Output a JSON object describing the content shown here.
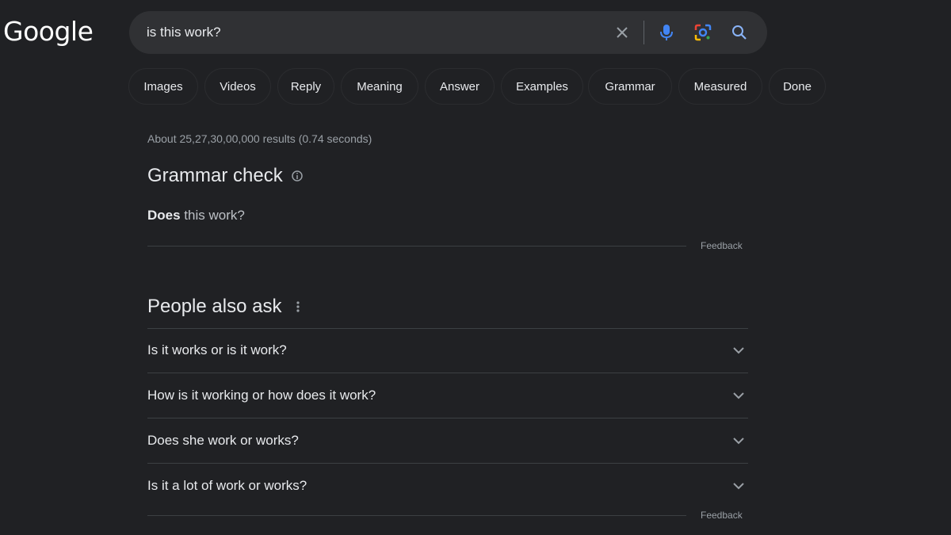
{
  "logo": "Google",
  "search": {
    "query": "is this work?"
  },
  "chips": [
    "Images",
    "Videos",
    "Reply",
    "Meaning",
    "Answer",
    "Examples",
    "Grammar",
    "Measured",
    "Done"
  ],
  "stats": "About 25,27,30,00,000 results (0.74 seconds)",
  "grammar": {
    "title": "Grammar check",
    "corrected_bold": "Does",
    "corrected_rest": " this work?",
    "feedback": "Feedback"
  },
  "paa": {
    "title": "People also ask",
    "questions": [
      "Is it works or is it work?",
      "How is it working or how does it work?",
      "Does she work or works?",
      "Is it a lot of work or works?"
    ],
    "feedback": "Feedback"
  },
  "colors": {
    "background": "#202124",
    "search_bg": "#303134",
    "text": "#e8eaed",
    "muted": "#9aa0a6",
    "mic_blue": "#4285f4"
  },
  "icons": {
    "clear": "close-icon",
    "mic": "microphone-icon",
    "lens": "google-lens-icon",
    "search": "search-icon",
    "info": "info-icon",
    "more": "more-vert-icon",
    "expand": "chevron-down-icon"
  }
}
